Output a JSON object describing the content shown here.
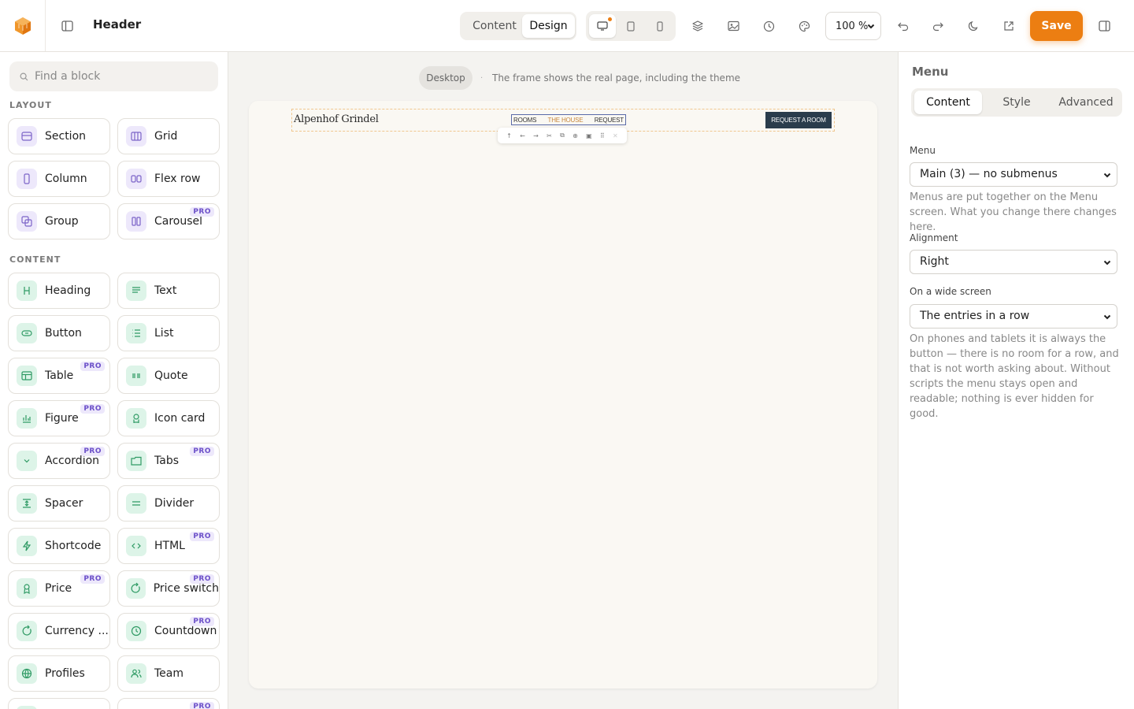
{
  "header": {
    "doc_title": "Header",
    "mode_tabs": [
      "Content",
      "Design"
    ],
    "zoom": "100 %",
    "save_label": "Save"
  },
  "left": {
    "search_placeholder": "Find a block",
    "layout_heading": "LAYOUT",
    "content_heading": "CONTENT",
    "pro_badge": "PRO",
    "layout_blocks": [
      {
        "label": "Section"
      },
      {
        "label": "Grid"
      },
      {
        "label": "Column"
      },
      {
        "label": "Flex row"
      },
      {
        "label": "Group"
      },
      {
        "label": "Carousel",
        "pro": true
      }
    ],
    "content_blocks": [
      {
        "label": "Heading"
      },
      {
        "label": "Text"
      },
      {
        "label": "Button"
      },
      {
        "label": "List"
      },
      {
        "label": "Table",
        "pro": true
      },
      {
        "label": "Quote"
      },
      {
        "label": "Figure",
        "pro": true
      },
      {
        "label": "Icon card"
      },
      {
        "label": "Accordion",
        "pro": true
      },
      {
        "label": "Tabs",
        "pro": true
      },
      {
        "label": "Spacer"
      },
      {
        "label": "Divider"
      },
      {
        "label": "Shortcode"
      },
      {
        "label": "HTML",
        "pro": true
      },
      {
        "label": "Price",
        "pro": true
      },
      {
        "label": "Price switch",
        "pro": true
      },
      {
        "label": "Currency ...",
        "pro": false
      },
      {
        "label": "Countdown",
        "pro": true
      },
      {
        "label": "Profiles"
      },
      {
        "label": "Team"
      }
    ]
  },
  "canvas": {
    "device_pill": "Desktop",
    "separator": "·",
    "note": "The frame shows the real page, including the theme",
    "site_name": "Alpenhof Grindel",
    "menu_items": [
      "ROOMS",
      "THE HOUSE",
      "REQUEST"
    ],
    "cta": "REQUEST A ROOM"
  },
  "inspector": {
    "title": "Menu",
    "tabs": [
      "Content",
      "Style",
      "Advanced"
    ],
    "menu_label": "Menu",
    "menu_value": "Main (3) — no submenus",
    "menu_help": "Menus are put together on the Menu screen. What you change there changes here.",
    "align_label": "Alignment",
    "align_value": "Right",
    "wide_label": "On a wide screen",
    "wide_value": "The entries in a row",
    "wide_help": "On phones and tablets it is always the button — there is no room for a row, and that is not worth asking about. Without scripts the menu stays open and readable; nothing is ever hidden for good."
  },
  "colors": {
    "accent": "#ec7e12",
    "pro_badge": "#6b4fc9",
    "layout_icon_bg": "#ede8fb",
    "content_icon_bg": "#ddf4e8",
    "cta_bg": "#2a3c4c",
    "active_menu": "#c7873e"
  }
}
